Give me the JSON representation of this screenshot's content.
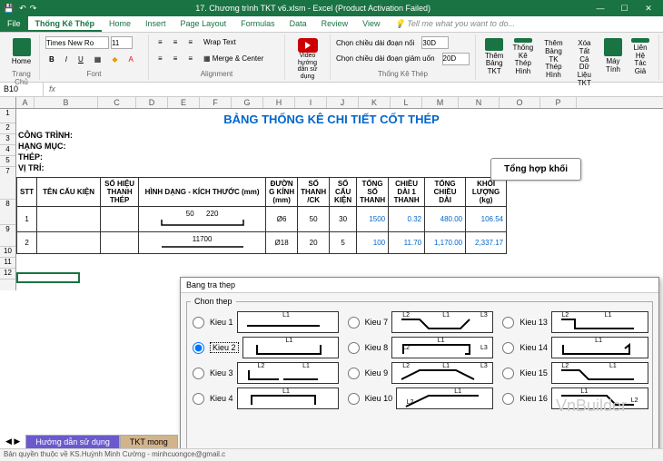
{
  "window": {
    "title": "17. Chương trình TKT v6.xlsm - Excel (Product Activation Failed)"
  },
  "tabs": {
    "file": "File",
    "active": "Thống Kê Thép",
    "home": "Home",
    "insert": "Insert",
    "pagelayout": "Page Layout",
    "formulas": "Formulas",
    "data": "Data",
    "review": "Review",
    "view": "View",
    "tell": "Tell me what you want to do..."
  },
  "ribbon": {
    "trangchu": "Trang Chủ",
    "font_name": "Times New Ro",
    "font_size": "11",
    "home": "Home",
    "font": "Font",
    "alignment": "Alignment",
    "wrap": "Wrap Text",
    "merge": "Merge & Center",
    "video": "Video hướng dẫn sử dụng",
    "chon1": "Chọn chiều dài đoạn nối",
    "chon2": "Chọn chiều dài đoạn giảm uốn",
    "val1": "30D",
    "val2": "20D",
    "thembang": "Thêm Bảng TKT",
    "thongke": "Thống Kê Thép Hình",
    "thembang2": "Thêm Bảng TK Thép Hình",
    "xoa": "Xóa Tất Cả Dữ Liệu TKT",
    "may": "Máy Tính",
    "lien": "Liên Hệ Tác Giả",
    "group_tkt": "Thống Kê Thép"
  },
  "namebox": "B10",
  "fx": "fx",
  "cols": [
    "A",
    "B",
    "C",
    "D",
    "E",
    "F",
    "G",
    "H",
    "I",
    "J",
    "K",
    "L",
    "M",
    "N",
    "O",
    "P"
  ],
  "rows1": [
    "1",
    "2",
    "3",
    "4",
    "5"
  ],
  "doc": {
    "title": "BẢNG THỐNG KÊ CHI TIẾT CỐT THÉP",
    "congtrinh": "CÔNG TRÌNH:",
    "hangmuc": "HẠNG MỤC:",
    "thep": "THÉP:",
    "vitri": "VỊ TRÍ:",
    "btn": "Tổng hợp khối"
  },
  "tbl": {
    "h_stt": "STT",
    "h_ten": "TÊN CẤU KIỆN",
    "h_sohieu": "SỐ HIỆU THANH THÉP",
    "h_hinh": "HÌNH DẠNG - KÍCH THƯỚC (mm)",
    "h_dk": "ĐƯỜN G KÍNH (mm)",
    "h_st": "SỐ THANH /CK",
    "h_sck": "SỐ CẤU KIỆN",
    "h_tst": "TỔNG SỐ THANH",
    "h_cd1": "CHIỀU DÀI 1 THANH",
    "h_tcd": "TỔNG CHIỀU DÀI",
    "h_kl": "KHỐI LƯỢNG (kg)",
    "r1": {
      "stt": "1",
      "d1": "50",
      "d2": "220",
      "dk": "Ø6",
      "st": "50",
      "sck": "30",
      "tst": "1500",
      "cd1": "0.32",
      "tcd": "480.00",
      "kl": "106.54"
    },
    "r2": {
      "stt": "2",
      "d1": "11700",
      "dk": "Ø18",
      "st": "20",
      "sck": "5",
      "tst": "100",
      "cd1": "11.70",
      "tcd": "1,170.00",
      "kl": "2,337.17"
    }
  },
  "dialog": {
    "title": "Bang tra thep",
    "legend": "Chon thep",
    "k1": "Kieu 1",
    "k2": "Kieu 2",
    "k3": "Kieu 3",
    "k4": "Kieu 4",
    "k7": "Kieu 7",
    "k8": "Kieu 8",
    "k9": "Kieu 9",
    "k10": "Kieu 10",
    "k13": "Kieu 13",
    "k14": "Kieu 14",
    "k15": "Kieu 15",
    "k16": "Kieu 16",
    "L1": "L1",
    "L2": "L2",
    "L3": "L3"
  },
  "sheets": {
    "hd": "Hướng dẫn sử dụng",
    "ac": "TKT mong"
  },
  "status": "Bản quyền thuộc về KS.Huỳnh Minh Cường - minhcuongce@gmail.c",
  "watermark": "VnBuilder"
}
